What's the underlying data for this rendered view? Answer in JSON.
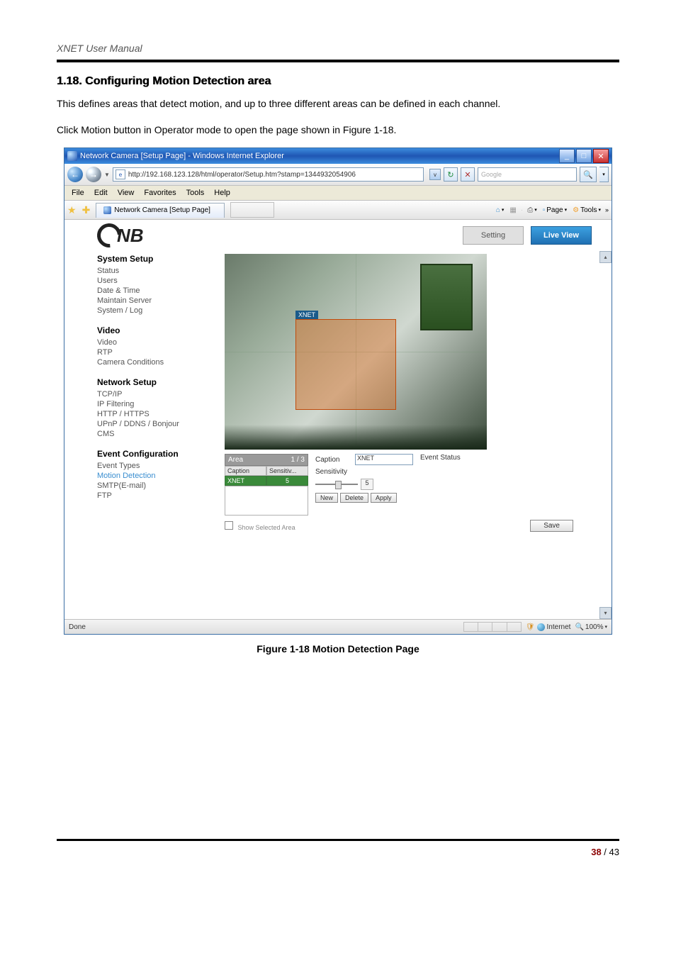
{
  "doc": {
    "header": "XNET User Manual",
    "section_title": "1.18. Configuring Motion Detection area",
    "para1": "This defines areas that detect motion, and up to three different areas can be defined in each channel.",
    "para2": "Click Motion button in Operator mode to open the page shown in Figure 1-18.",
    "figure_caption": "Figure 1-18 Motion Detection Page",
    "page_current": "38",
    "page_sep": " / ",
    "page_total": "43"
  },
  "browser": {
    "title": "Network Camera [Setup Page] - Windows Internet Explorer",
    "url": "http://192.168.123.128/html/operator/Setup.htm?stamp=1344932054906",
    "search_placeholder": "Google",
    "menus": [
      "File",
      "Edit",
      "View",
      "Favorites",
      "Tools",
      "Help"
    ],
    "tab_title": "Network Camera [Setup Page]",
    "cmd_page": "Page",
    "cmd_tools": "Tools",
    "status_left": "Done",
    "status_zone": "Internet",
    "status_zoom": "100%"
  },
  "app": {
    "logo_text": "CNB",
    "btn_setting": "Setting",
    "btn_live": "Live View",
    "sidebar": {
      "g1": "System Setup",
      "g1_items": [
        "Status",
        "Users",
        "Date & Time",
        "Maintain Server",
        "System / Log"
      ],
      "g2": "Video",
      "g2_items": [
        "Video",
        "RTP",
        "Camera Conditions"
      ],
      "g3": "Network Setup",
      "g3_items": [
        "TCP/IP",
        "IP Filtering",
        "HTTP / HTTPS",
        "UPnP / DDNS / Bonjour",
        "CMS"
      ],
      "g4": "Event Configuration",
      "g4_items": [
        "Event Types",
        "Motion Detection",
        "SMTP(E-mail)",
        "FTP"
      ]
    },
    "motion_label": "XNET",
    "controls": {
      "area_title": "Area",
      "area_count": "1 / 3",
      "col_caption": "Caption",
      "col_sens": "Sensitiv...",
      "row_caption": "XNET",
      "row_sens": "5",
      "caption_label": "Caption",
      "caption_value": "XNET",
      "sens_label": "Sensitivity",
      "sens_value": "5",
      "btn_new": "New",
      "btn_delete": "Delete",
      "btn_apply": "Apply",
      "event_status_label": "Event Status",
      "show_selected": "Show Selected Area",
      "btn_save": "Save"
    }
  }
}
